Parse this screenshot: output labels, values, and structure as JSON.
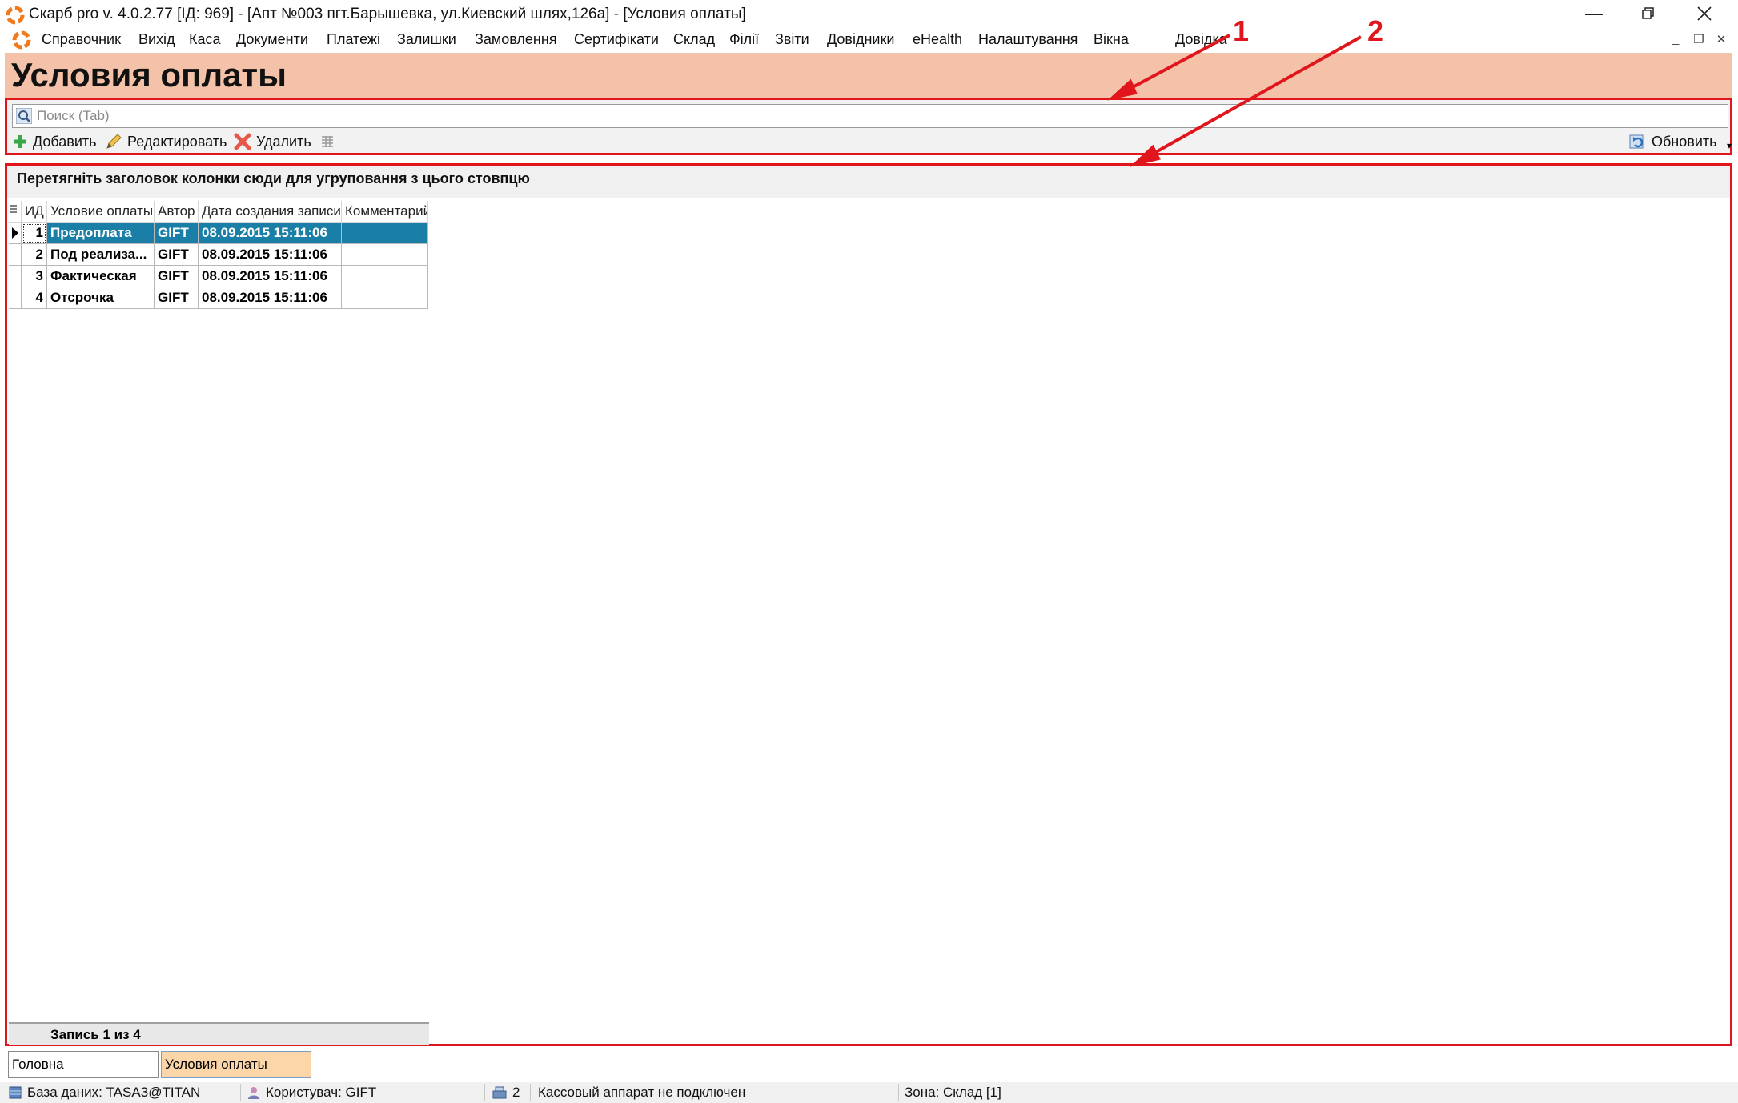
{
  "window": {
    "title": "Скарб pro v. 4.0.2.77 [ІД: 969] - [Апт №003 пгт.Барышевка, ул.Киевский шлях,126а] - [Условия оплаты]",
    "minimize_icon": "minimize-icon",
    "restore_icon": "restore-icon",
    "close_icon": "close-icon"
  },
  "menu": {
    "items": [
      "Справочник",
      "Вихід",
      "Каса",
      "Документи",
      "Платежі",
      "Залишки",
      "Замовлення",
      "Сертифікати",
      "Склад",
      "Філії",
      "Звіти",
      "Довідники",
      "eHealth",
      "Налаштування",
      "Вікна",
      "Довідка"
    ]
  },
  "page": {
    "title": "Условия оплаты"
  },
  "toolbar": {
    "search_placeholder": "Поиск (Tab)",
    "add_label": "Добавить",
    "edit_label": "Редактировать",
    "delete_label": "Удалить",
    "refresh_label": "Обновить"
  },
  "grid": {
    "group_hint": "Перетягніть заголовок колонки сюди для угруповання з цього стовпцю",
    "columns": [
      "ИД",
      "Условие оплаты",
      "Автор",
      "Дата создания записи",
      "Комментарий"
    ],
    "rows": [
      {
        "id": "1",
        "condition": "Предоплата",
        "author": "GIFT",
        "created": "08.09.2015 15:11:06",
        "comment": ""
      },
      {
        "id": "2",
        "condition": "Под реализа...",
        "author": "GIFT",
        "created": "08.09.2015 15:11:06",
        "comment": ""
      },
      {
        "id": "3",
        "condition": "Фактическая",
        "author": "GIFT",
        "created": "08.09.2015 15:11:06",
        "comment": ""
      },
      {
        "id": "4",
        "condition": "Отсрочка",
        "author": "GIFT",
        "created": "08.09.2015 15:11:06",
        "comment": ""
      }
    ],
    "footer": "Запись 1 из 4"
  },
  "tabs": [
    "Головна",
    "Условия оплаты"
  ],
  "status": {
    "database": "База даних: TASA3@TITAN",
    "user": "Користувач: GIFT",
    "cash_count": "2",
    "cash_status": "Кассовый аппарат не подключен",
    "zone": "Зона: Склад [1]"
  },
  "annotations": [
    "1",
    "2"
  ],
  "colors": {
    "header_bg": "#f4c2a8",
    "highlight_red": "#e0161c",
    "selection_blue": "#1a7fa6",
    "active_tab": "#fcd5a8"
  }
}
